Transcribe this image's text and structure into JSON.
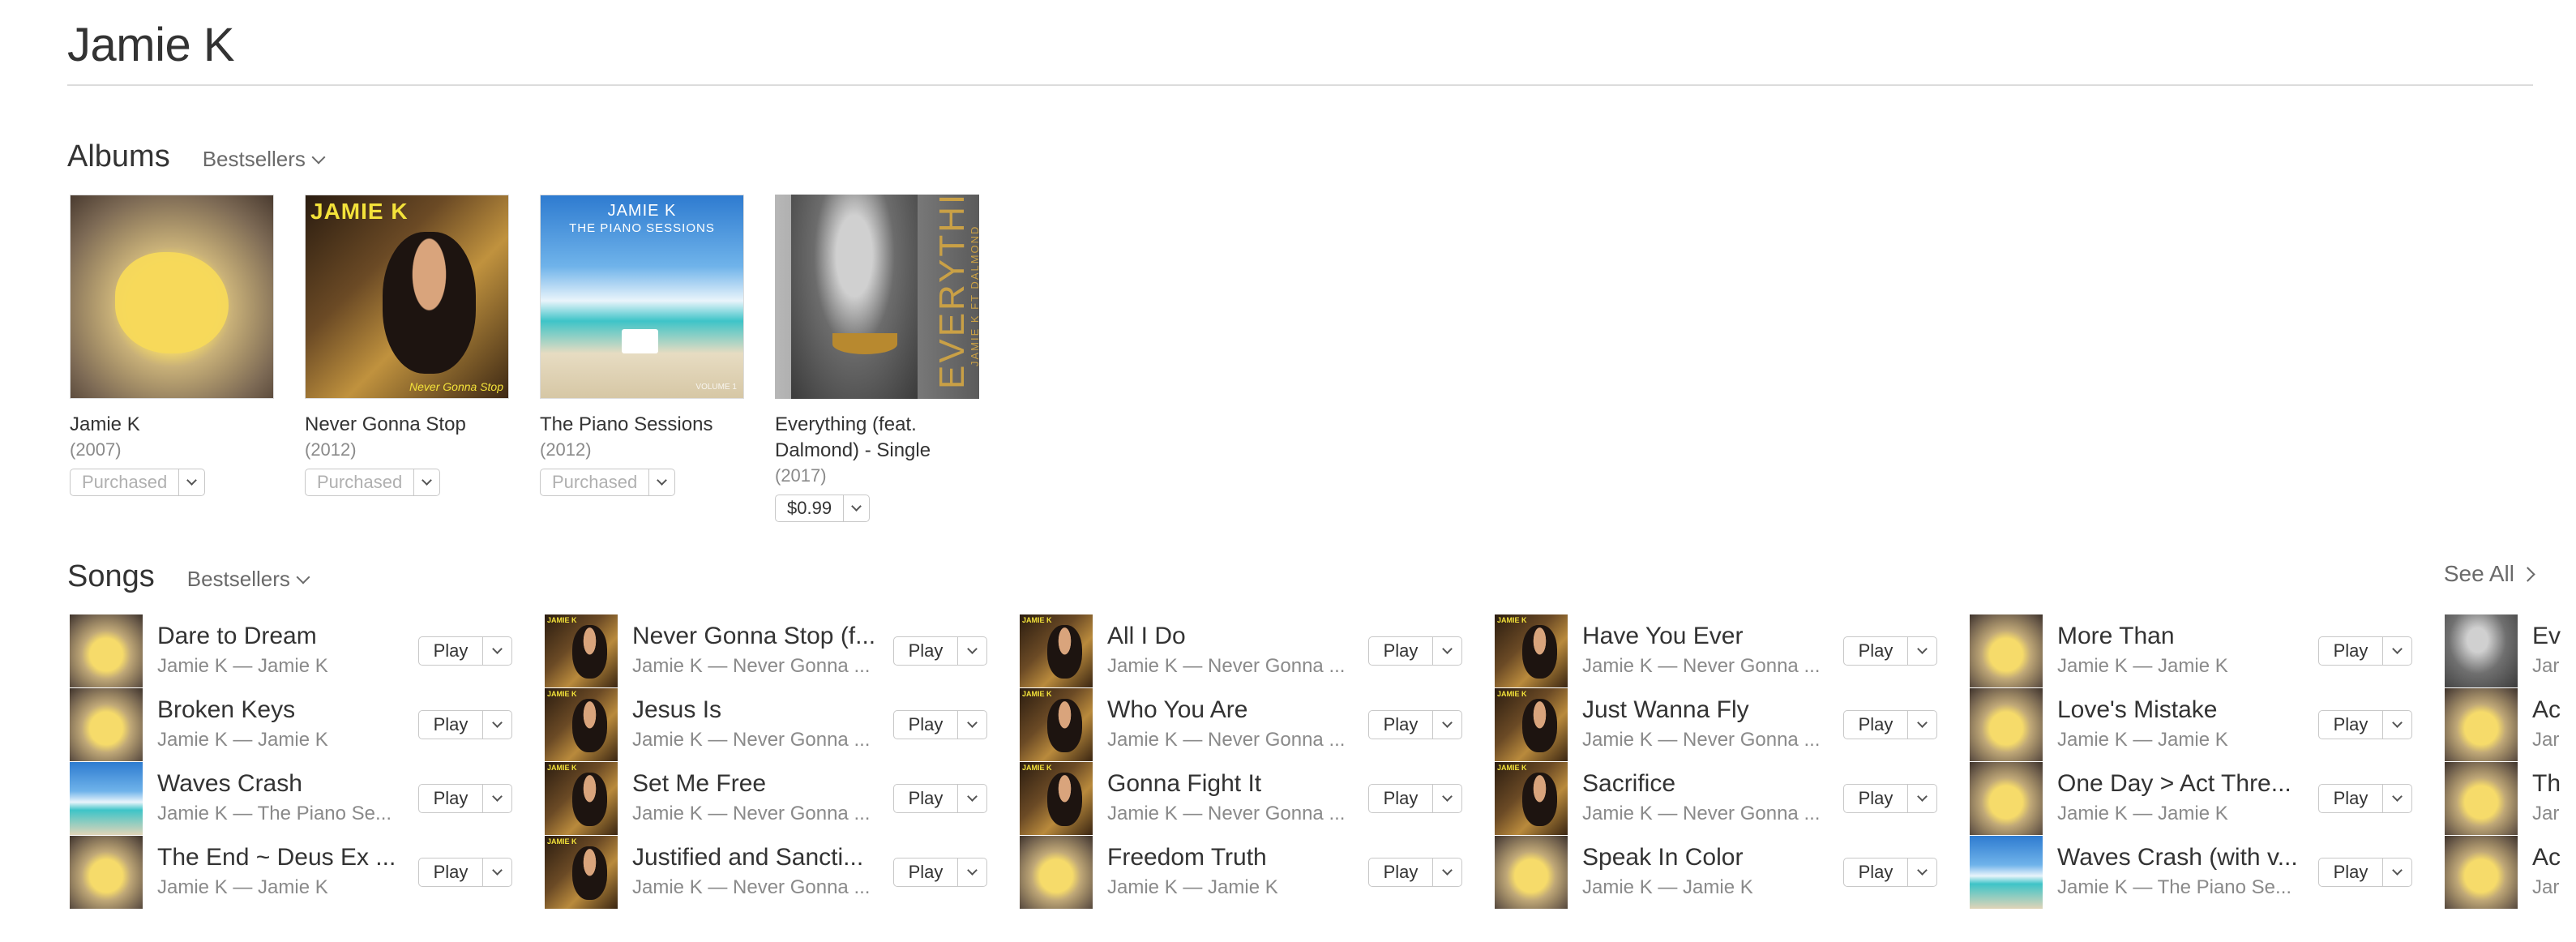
{
  "artist": {
    "name": "Jamie K"
  },
  "albums_section": {
    "title": "Albums",
    "sort_label": "Bestsellers",
    "items": [
      {
        "title": "Jamie K",
        "year": "(2007)",
        "button": "Purchased",
        "art": "yellow"
      },
      {
        "title": "Never Gonna Stop",
        "year": "(2012)",
        "button": "Purchased",
        "art": "never",
        "art_text": "JAMIE K",
        "art_sub": "Never Gonna Stop"
      },
      {
        "title": "The Piano Sessions",
        "year": "(2012)",
        "button": "Purchased",
        "art": "piano",
        "art_text": "JAMIE K",
        "art_sub": "THE PIANO SESSIONS",
        "art_vol": "VOLUME 1"
      },
      {
        "title_line1": "Everything (feat.",
        "title_line2": "Dalmond) - Single",
        "year": "(2017)",
        "button": "$0.99",
        "art": "every",
        "art_text": "EVERYTHING",
        "art_sub": "JAMIE K FT DALMOND"
      }
    ]
  },
  "songs_section": {
    "title": "Songs",
    "sort_label": "Bestsellers",
    "see_all": "See All",
    "play_label": "Play",
    "columns": [
      [
        {
          "title": "Dare to Dream",
          "sub": "Jamie K — Jamie K",
          "art": "yellow"
        },
        {
          "title": "Broken Keys",
          "sub": "Jamie K — Jamie K",
          "art": "yellow"
        },
        {
          "title": "Waves Crash",
          "sub": "Jamie K — The Piano Se...",
          "art": "piano"
        },
        {
          "title": "The End ~ Deus Ex ...",
          "sub": "Jamie K — Jamie K",
          "art": "yellow"
        }
      ],
      [
        {
          "title": "Never Gonna Stop (f...",
          "sub": "Jamie K — Never Gonna ...",
          "art": "never"
        },
        {
          "title": "Jesus Is",
          "sub": "Jamie K — Never Gonna ...",
          "art": "never"
        },
        {
          "title": "Set Me Free",
          "sub": "Jamie K — Never Gonna ...",
          "art": "never"
        },
        {
          "title": "Justified and Sancti...",
          "sub": "Jamie K — Never Gonna ...",
          "art": "never"
        }
      ],
      [
        {
          "title": "All I Do",
          "sub": "Jamie K — Never Gonna ...",
          "art": "never"
        },
        {
          "title": "Who You Are",
          "sub": "Jamie K — Never Gonna ...",
          "art": "never"
        },
        {
          "title": "Gonna Fight It",
          "sub": "Jamie K — Never Gonna ...",
          "art": "never"
        },
        {
          "title": "Freedom Truth",
          "sub": "Jamie K — Jamie K",
          "art": "yellow"
        }
      ],
      [
        {
          "title": "Have You Ever",
          "sub": "Jamie K — Never Gonna ...",
          "art": "never"
        },
        {
          "title": "Just Wanna Fly",
          "sub": "Jamie K — Never Gonna ...",
          "art": "never"
        },
        {
          "title": "Sacrifice",
          "sub": "Jamie K — Never Gonna ...",
          "art": "never"
        },
        {
          "title": "Speak In Color",
          "sub": "Jamie K — Jamie K",
          "art": "yellow"
        }
      ],
      [
        {
          "title": "More Than",
          "sub": "Jamie K — Jamie K",
          "art": "yellow"
        },
        {
          "title": "Love's Mistake",
          "sub": "Jamie K — Jamie K",
          "art": "yellow"
        },
        {
          "title": "One Day > Act Thre...",
          "sub": "Jamie K — Jamie K",
          "art": "yellow"
        },
        {
          "title": "Waves Crash (with v...",
          "sub": "Jamie K — The Piano Se...",
          "art": "piano"
        }
      ],
      [
        {
          "title": "Ev",
          "sub": "Jar",
          "art": "every"
        },
        {
          "title": "Ac",
          "sub": "Jar",
          "art": "yellow"
        },
        {
          "title": "Th",
          "sub": "Jar",
          "art": "yellow"
        },
        {
          "title": "Ac",
          "sub": "Jar",
          "art": "yellow"
        }
      ]
    ]
  }
}
